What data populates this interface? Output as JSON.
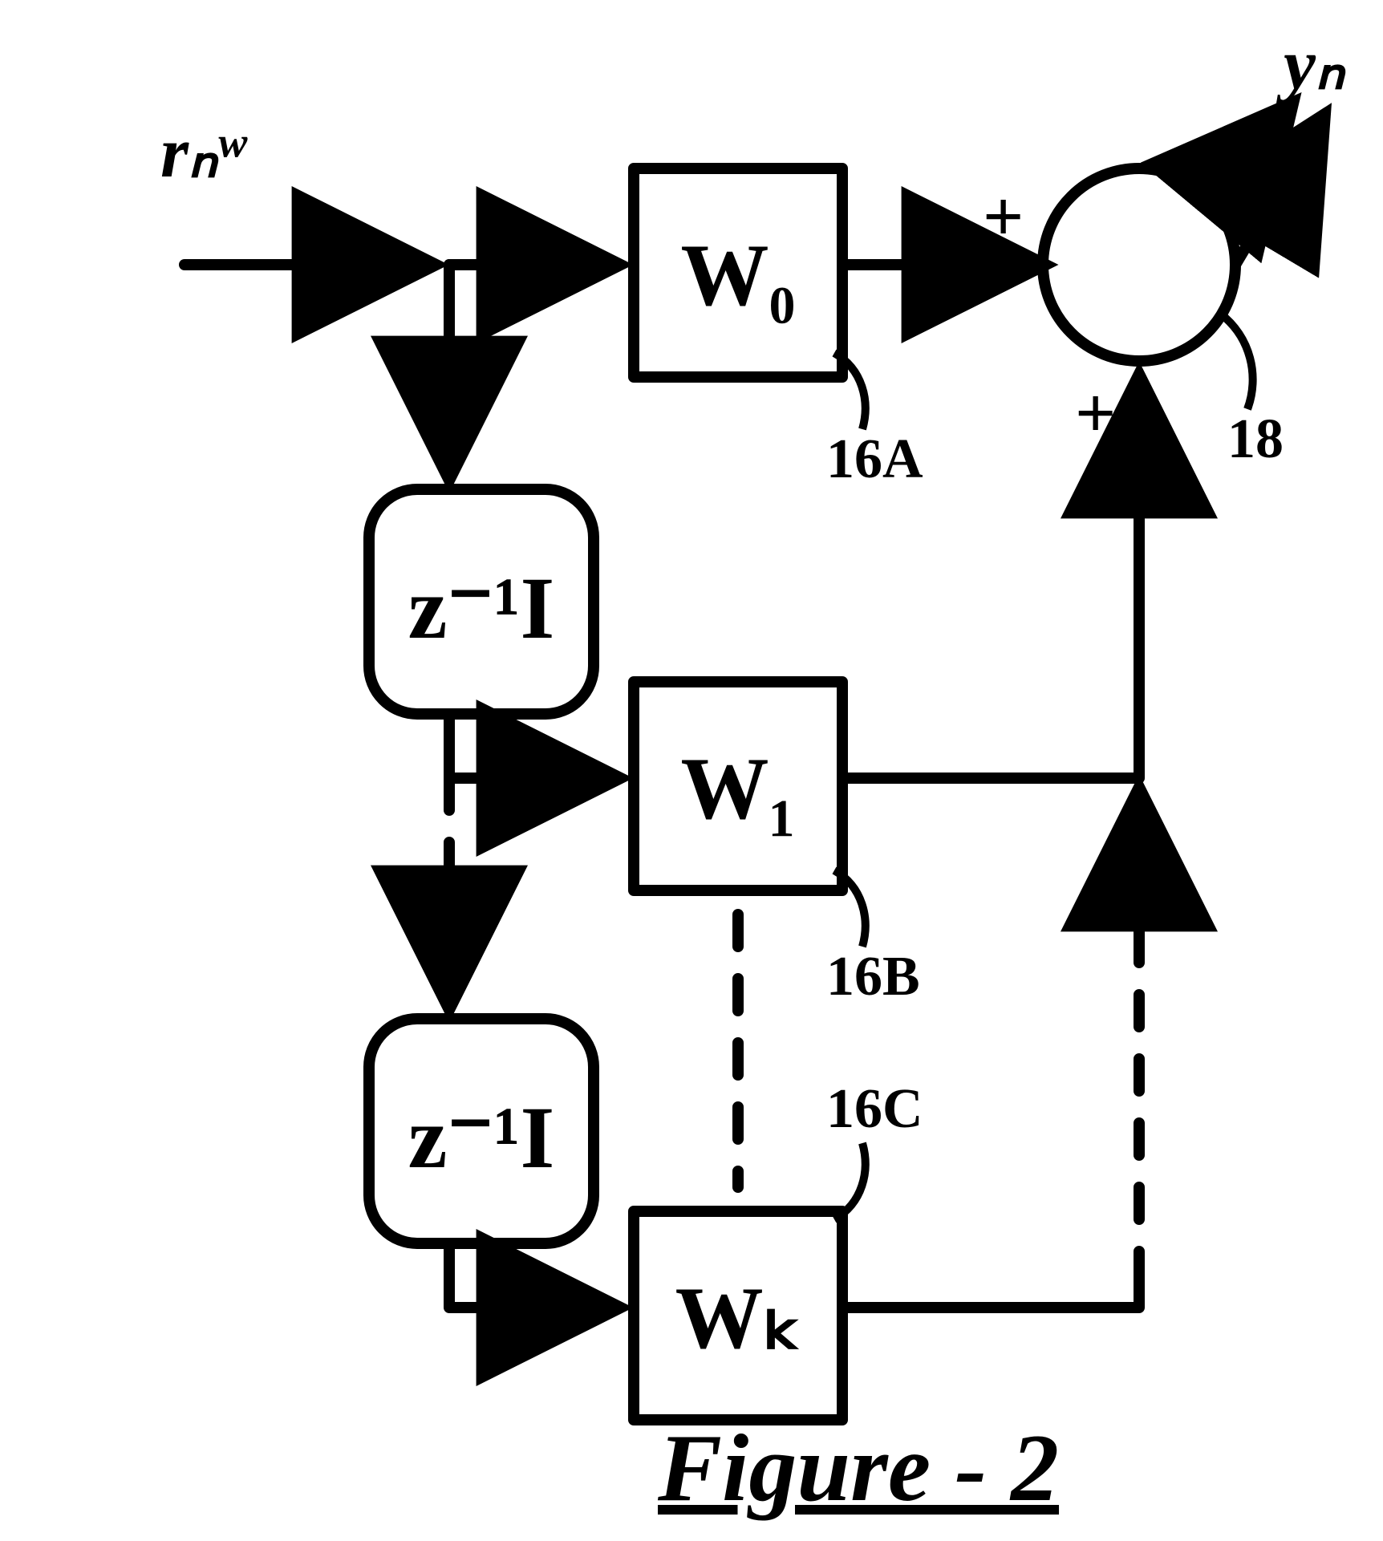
{
  "input_label": "rₙʷ",
  "output_label": "yₙ",
  "delay_label": "z⁻¹I",
  "weights": {
    "w0": {
      "label": "W₀",
      "ref": "16A"
    },
    "w1": {
      "label": "W₁",
      "ref": "16B"
    },
    "wk": {
      "label": "Wₖ",
      "ref": "16C"
    }
  },
  "summer_ref": "18",
  "plus": "+",
  "figure_caption": "Figure - 2"
}
